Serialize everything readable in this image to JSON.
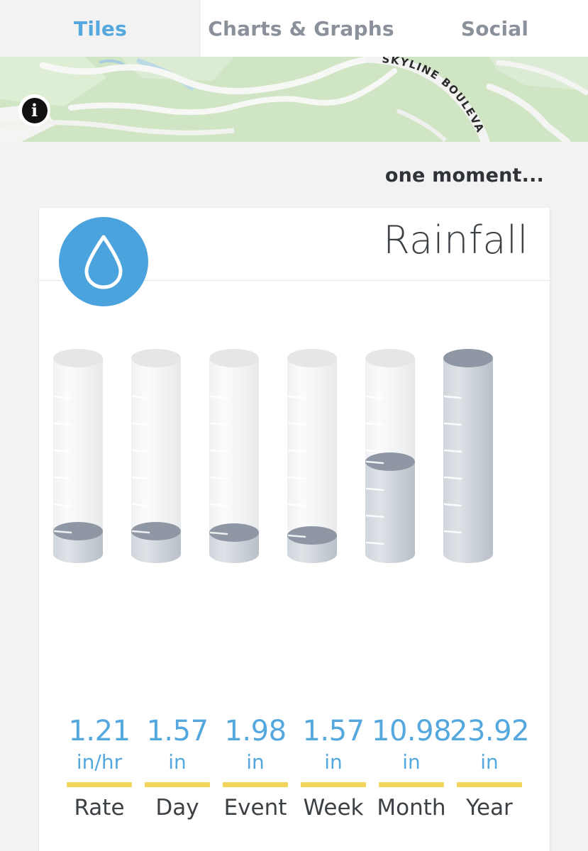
{
  "tabs": [
    {
      "label": "Tiles",
      "active": true
    },
    {
      "label": "Charts & Graphs",
      "active": false
    },
    {
      "label": "Social",
      "active": false
    }
  ],
  "map": {
    "street_label": "SKYLINE BOULEVA",
    "info_glyph": "i",
    "land_color": "#cfe5c4",
    "road_color": "#f4f4f2",
    "water_color": "#a9cde0"
  },
  "status": {
    "text": "one moment..."
  },
  "card": {
    "title": "Rainfall",
    "icon": "water-drop-icon",
    "icon_bg": "#4ba3dd",
    "accent_color": "#54a8de",
    "rule_color": "#f3d45c"
  },
  "chart_data": {
    "type": "bar",
    "title": "Rainfall",
    "xlabel": "",
    "ylabel": "",
    "categories": [
      "Rate",
      "Day",
      "Event",
      "Week",
      "Month",
      "Year"
    ],
    "values": [
      1.21,
      1.57,
      1.98,
      1.57,
      10.98,
      23.92
    ],
    "units": [
      "in/hr",
      "in",
      "in",
      "in",
      "in",
      "in"
    ],
    "value_labels": [
      "1.21",
      "1.57",
      "1.98",
      "1.57",
      "10.98",
      "23.92"
    ],
    "fill_fractions": [
      0.115,
      0.115,
      0.115,
      0.105,
      0.45,
      1.0
    ],
    "ylim": [
      0,
      24
    ],
    "grid": false,
    "legend": "none",
    "style": "rain-gauge-cylinders"
  },
  "gauges": [
    {
      "label": "Rate",
      "value": "1.21",
      "unit": "in/hr",
      "fill": 0.115
    },
    {
      "label": "Day",
      "value": "1.57",
      "unit": "in",
      "fill": 0.115
    },
    {
      "label": "Event",
      "value": "1.98",
      "unit": "in",
      "fill": 0.115
    },
    {
      "label": "Week",
      "value": "1.57",
      "unit": "in",
      "fill": 0.105
    },
    {
      "label": "Month",
      "value": "10.98",
      "unit": "in",
      "fill": 0.45
    },
    {
      "label": "Year",
      "value": "23.92",
      "unit": "in",
      "fill": 1.0
    }
  ]
}
